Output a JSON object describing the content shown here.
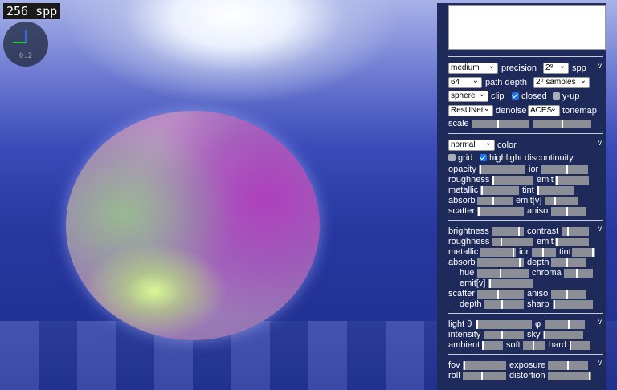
{
  "overlay": {
    "spp_badge": "256 spp",
    "gizmo_zoom": "0.2"
  },
  "render_settings": {
    "precision": "medium",
    "precision_label": "precision",
    "spp": "2⁸",
    "spp_label": "spp",
    "path_depth": "64",
    "path_depth_label": "path depth",
    "samples": "2⁰ samples",
    "clip_shape": "sphere",
    "clip_label": "clip",
    "closed_label": "closed",
    "closed_checked": true,
    "yup_label": "y-up",
    "yup_checked": false,
    "denoiser": "ResUNet",
    "denoise_label": "denoise",
    "tonemapper": "ACES",
    "tonemap_label": "tonemap",
    "scale_label": "scale",
    "collapse": "v"
  },
  "material": {
    "view_mode": "normal",
    "color_label": "color",
    "grid_label": "grid",
    "grid_checked": false,
    "highlight_label": "highlight discontinuity",
    "highlight_checked": true,
    "opacity": "opacity",
    "ior": "ior",
    "roughness": "roughness",
    "emit": "emit",
    "metallic": "metallic",
    "tint": "tint",
    "absorb": "absorb",
    "emitv": "emit[v]",
    "scatter": "scatter",
    "aniso": "aniso",
    "collapse": "v"
  },
  "adjust": {
    "brightness": "brightness",
    "contrast": "contrast",
    "roughness": "roughness",
    "emit": "emit",
    "metallic": "metallic",
    "ior": "ior",
    "tint": "tint",
    "absorb": "absorb",
    "depth": "depth",
    "hue": "hue",
    "chroma": "chroma",
    "emitv": "emit[v]",
    "scatter": "scatter",
    "aniso": "aniso",
    "depth2": "depth",
    "sharp": "sharp",
    "collapse": "v"
  },
  "lighting": {
    "light_theta": "light θ",
    "phi": "φ",
    "intensity": "intensity",
    "sky": "sky",
    "ambient": "ambient",
    "soft": "soft",
    "hard": "hard",
    "collapse": "v"
  },
  "camera": {
    "fov": "fov",
    "exposure": "exposure",
    "roll": "roll",
    "distortion": "distortion",
    "collapse": "v"
  },
  "slider_levels": {
    "scale": 0.45,
    "scale2": 0.5,
    "opacity": 0.02,
    "ior": 0.55,
    "roughness": 0.02,
    "emit": 0.02,
    "metallic": 0.02,
    "tint": 0.02,
    "absorb": 0.45,
    "emitv": 0.3,
    "scatter": 0.02,
    "aniso": 0.45,
    "brightness": 0.88,
    "contrast": 0.22,
    "roughness2": 0.22,
    "emit2": 0.02,
    "metallic2": 0.95,
    "ior2": 0.45,
    "tint2": 0.95,
    "absorb2": 0.92,
    "depth": 0.45,
    "hue": 0.45,
    "chroma": 0.45,
    "emitv2": 0.02,
    "scatter2": 0.45,
    "aniso2": 0.45,
    "depth2": 0.45,
    "sharp": 0.02,
    "light_theta": 0.02,
    "phi": 0.6,
    "intensity": 0.45,
    "sky": 0.02,
    "ambient": 0.02,
    "soft": 0.45,
    "hard": 0.02,
    "fov": 0.02,
    "exposure": 0.5,
    "roll": 0.45,
    "distortion": 0.98
  }
}
